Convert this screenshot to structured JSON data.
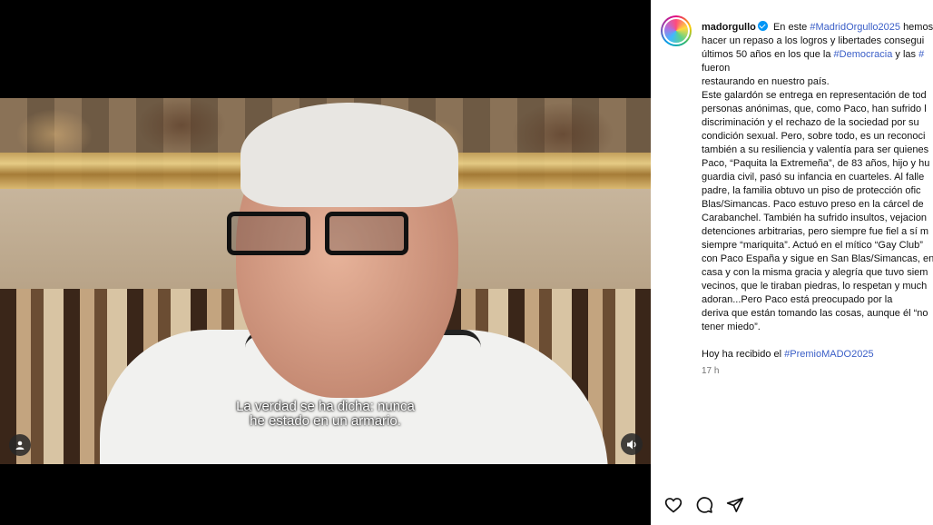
{
  "video": {
    "subtitle_lines": [
      "La verdad se ha dicha: nunca",
      "he estado en un armario."
    ]
  },
  "post": {
    "username": "madorgullo",
    "caption_intro": "En este",
    "hashtag_1": "#MadridOrgullo2025",
    "caption_after_hash1": "hemos",
    "line2": "hacer un repaso a los logros y libertades consegui",
    "line3_pre": "últimos 50 años en los que la",
    "hashtag_2": "#Democracia",
    "line3_mid": "y las",
    "hashtag_3": "#",
    "line4": "fueron",
    "line5": "restaurando en nuestro país.",
    "line6": "Este galardón se entrega en representación de tod",
    "line7": "personas anónimas, que, como Paco, han sufrido l",
    "line8": "discriminación y el rechazo de la sociedad por su",
    "line9": "condición sexual. Pero, sobre todo, es un reconoci",
    "line10": "también a su resiliencia y valentía para ser quienes",
    "line11": "Paco, “Paquita la Extremeña”, de 83 años, hijo y hu",
    "line12": "guardia civil, pasó su infancia en cuarteles. Al falle",
    "line13": "padre, la familia obtuvo un piso de protección ofic",
    "line14": "Blas/Simancas. Paco estuvo preso en la cárcel de",
    "line15": "Carabanchel. También ha sufrido insultos, vejacion",
    "line16": "detenciones arbitrarias, pero siempre fue fiel a sí m",
    "line17": "siempre “mariquita”. Actuó en el mítico “Gay Club”",
    "line18": "con Paco España y sigue en San Blas/Simancas, en",
    "line19": "casa y con la misma gracia y alegría que tuvo siem",
    "line20": "vecinos, que le tiraban piedras, lo respetan y much",
    "line21": "adoran...Pero Paco está preocupado por la",
    "line22": "deriva que están tomando las cosas, aunque él “no",
    "line23": "tener miedo”.",
    "final_pre": "Hoy ha recibido el",
    "hashtag_4": "#PremioMADO2025",
    "time": "17 h"
  },
  "icons": {
    "like": "heart-icon",
    "comment": "comment-icon",
    "share": "send-icon",
    "tag": "user-tag-icon",
    "mute": "speaker-icon",
    "verified": "verified-badge-icon"
  },
  "colors": {
    "hashtag": "#3a5ec7",
    "verified": "#0095f6"
  }
}
